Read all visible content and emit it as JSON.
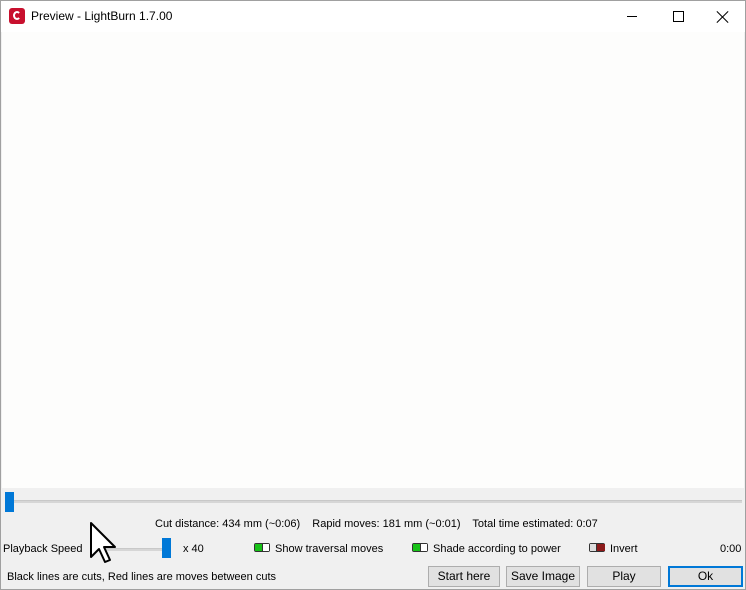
{
  "window": {
    "title": "Preview - LightBurn 1.7.00",
    "controls": [
      "minimize",
      "maximize",
      "close"
    ]
  },
  "timeline": {
    "progress": 0.0
  },
  "stats": {
    "cut_distance": "Cut distance: 434 mm (~0:06)",
    "rapid_moves": "Rapid moves: 181 mm (~0:01)",
    "total_time": "Total time estimated: 0:07"
  },
  "playback": {
    "label": "Playback Speed",
    "multiplier": "x 40",
    "speed_fraction": 1.0,
    "elapsed": "0:00"
  },
  "options": {
    "show_traversal_moves": {
      "label": "Show traversal moves",
      "checked": true
    },
    "shade_according_to_power": {
      "label": "Shade according to power",
      "checked": true
    },
    "invert": {
      "label": "Invert",
      "checked": false
    }
  },
  "status": {
    "hint": "Black lines are cuts, Red lines are moves between cuts"
  },
  "buttons": {
    "start_here": "Start here",
    "save_image": "Save Image",
    "play": "Play",
    "ok": "Ok"
  },
  "colors": {
    "accent": "#0078d7",
    "toggle_on": "#17c217",
    "toggle_off": "#8b1a1a",
    "brand": "#c8102e"
  }
}
